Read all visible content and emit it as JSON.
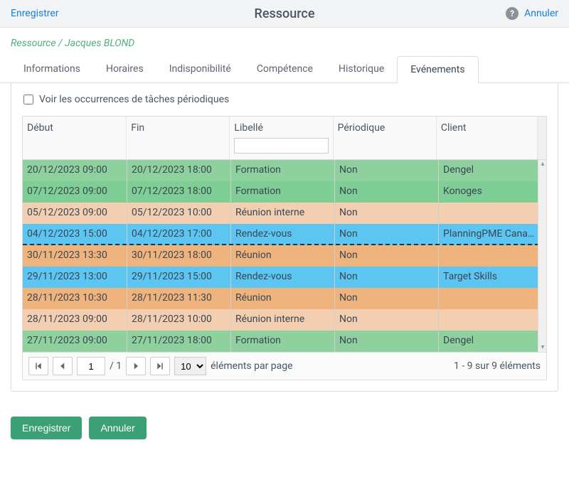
{
  "header": {
    "save": "Enregistrer",
    "title": "Ressource",
    "cancel": "Annuler"
  },
  "breadcrumb": "Ressource / Jacques BLOND",
  "tabs": [
    "Informations",
    "Horaires",
    "Indisponibilité",
    "Compétence",
    "Historique",
    "Evénements"
  ],
  "activeTab": 5,
  "checkbox": {
    "label": "Voir les occurrences de tâches périodiques",
    "checked": false
  },
  "grid": {
    "headers": {
      "debut": "Début",
      "fin": "Fin",
      "libelle": "Libellé",
      "periodique": "Périodique",
      "client": "Client"
    },
    "filter_libelle": "",
    "rows": [
      {
        "debut": "20/12/2023 09:00",
        "fin": "20/12/2023 18:00",
        "libelle": "Formation",
        "periodique": "Non",
        "client": "Dengel",
        "color": "row-green"
      },
      {
        "debut": "07/12/2023 09:00",
        "fin": "07/12/2023 18:00",
        "libelle": "Formation",
        "periodique": "Non",
        "client": "Konoges",
        "color": "row-green2"
      },
      {
        "debut": "05/12/2023 09:00",
        "fin": "05/12/2023 10:00",
        "libelle": "Réunion interne",
        "periodique": "Non",
        "client": "",
        "color": "row-peach"
      },
      {
        "debut": "04/12/2023 15:00",
        "fin": "04/12/2023 17:00",
        "libelle": "Rendez-vous",
        "periodique": "Non",
        "client": "PlanningPME Canada",
        "color": "row-blue",
        "divider": true
      },
      {
        "debut": "30/11/2023 13:30",
        "fin": "30/11/2023 18:00",
        "libelle": "Réunion",
        "periodique": "Non",
        "client": "",
        "color": "row-orange"
      },
      {
        "debut": "29/11/2023 13:00",
        "fin": "29/11/2023 15:00",
        "libelle": "Rendez-vous",
        "periodique": "Non",
        "client": "Target Skills",
        "color": "row-blue"
      },
      {
        "debut": "28/11/2023 10:30",
        "fin": "28/11/2023 11:30",
        "libelle": "Réunion",
        "periodique": "Non",
        "client": "",
        "color": "row-orange"
      },
      {
        "debut": "28/11/2023 09:00",
        "fin": "28/11/2023 10:00",
        "libelle": "Réunion interne",
        "periodique": "Non",
        "client": "",
        "color": "row-peach"
      },
      {
        "debut": "27/11/2023 09:00",
        "fin": "27/11/2023 18:00",
        "libelle": "Formation",
        "periodique": "Non",
        "client": "Dengel",
        "color": "row-green"
      }
    ]
  },
  "pager": {
    "page": "1",
    "total_pages": "/ 1",
    "page_size": "10",
    "per_page_label": "éléments par page",
    "info": "1 - 9 sur 9 éléments"
  },
  "footer": {
    "save": "Enregistrer",
    "cancel": "Annuler"
  }
}
